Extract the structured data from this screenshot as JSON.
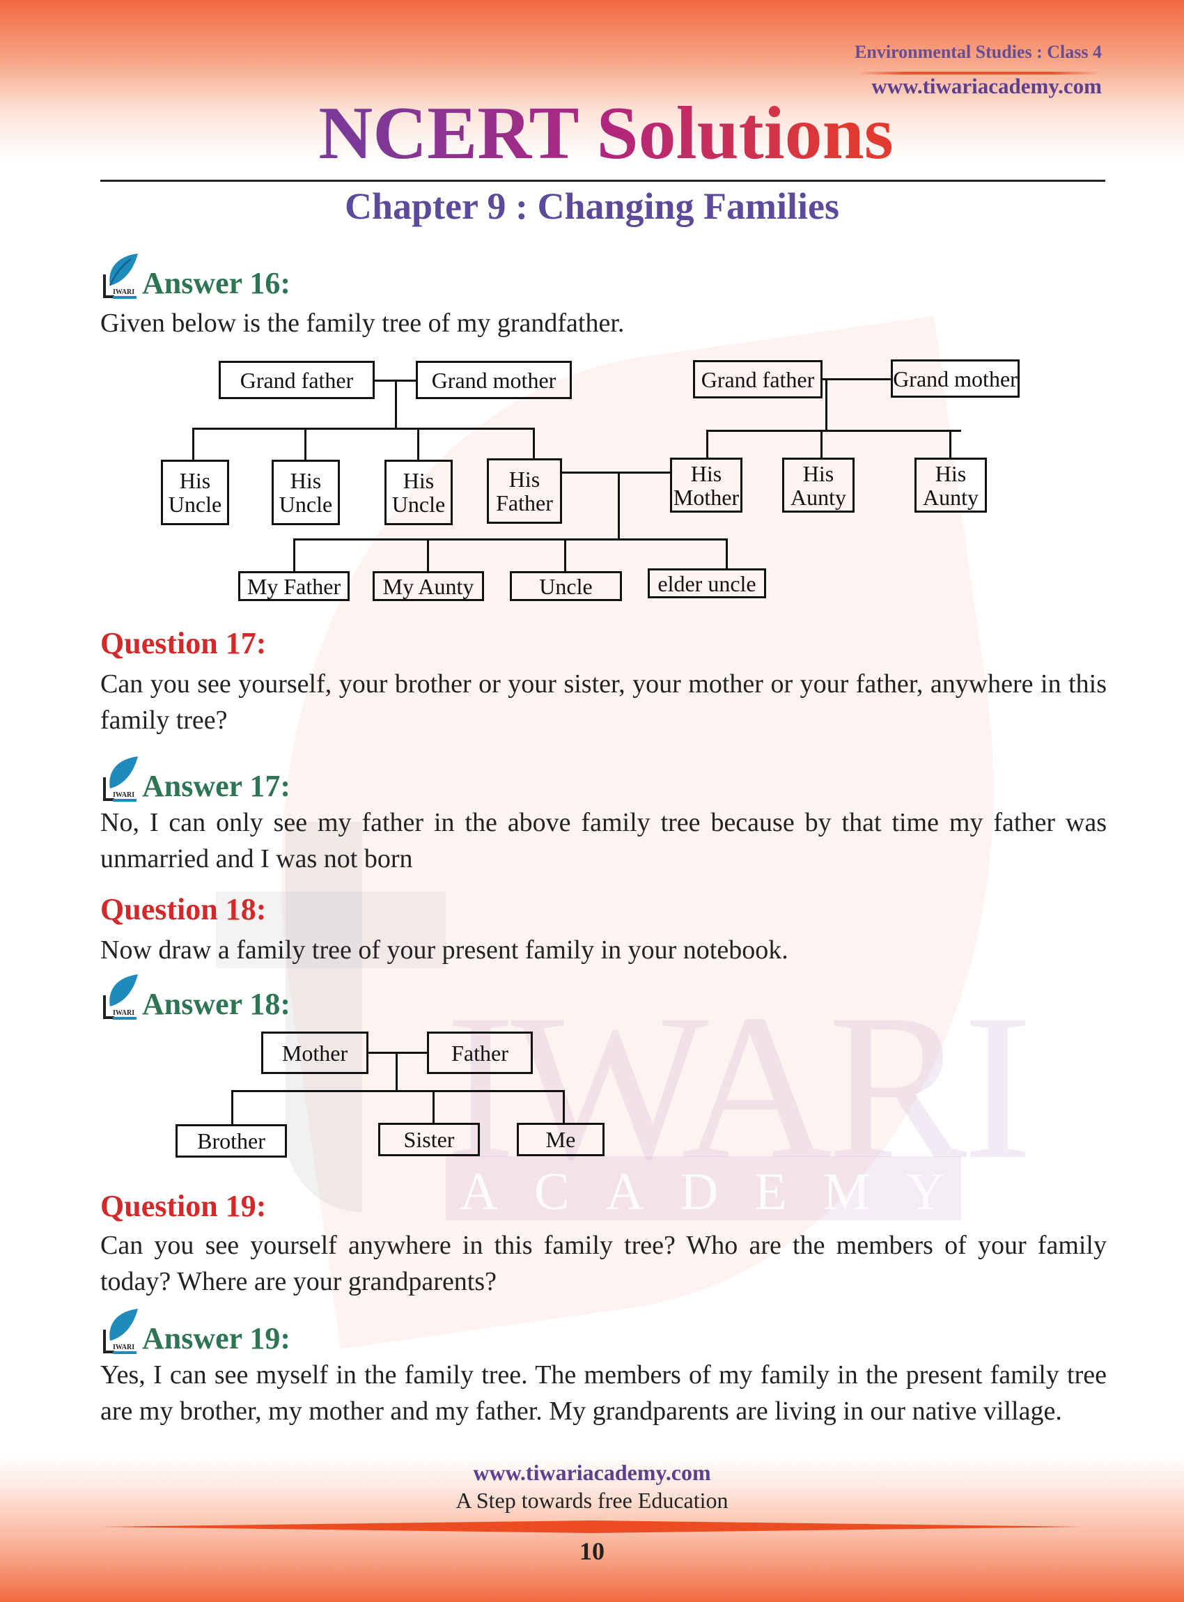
{
  "header": {
    "subject": "Environmental Studies : Class 4",
    "website": "www.tiwariacademy.com",
    "title": "NCERT Solutions",
    "chapter": "Chapter 9 : Changing Families"
  },
  "watermark": {
    "brand": "IWARI",
    "sub": "ACADEMY"
  },
  "logo": {
    "text": "IWARI"
  },
  "sections": [
    {
      "type": "answer",
      "heading": "Answer 16:",
      "text": "Given below is the family tree of my grandfather."
    },
    {
      "type": "question",
      "heading": "Question 17:",
      "text": "Can you see yourself, your brother or your sister, your mother or your father, anywhere in this family tree?"
    },
    {
      "type": "answer",
      "heading": "Answer 17:",
      "text": "No, I can only see my father in the above family tree because by that time my father was unmarried and I was not born"
    },
    {
      "type": "question",
      "heading": "Question 18:",
      "text": "Now draw a family tree of your present family in your notebook."
    },
    {
      "type": "answer",
      "heading": "Answer 18:",
      "text": ""
    },
    {
      "type": "question",
      "heading": "Question 19:",
      "text": "Can you see yourself anywhere in this family tree? Who are the members of your family today? Where are your grandparents?"
    },
    {
      "type": "answer",
      "heading": "Answer 19:",
      "text": "Yes, I can see myself in the family tree. The members of my family in the present family tree  are my brother, my mother and my father. My grandparents are living in our native village."
    }
  ],
  "tree1": {
    "paternal_grandparents": [
      "Grand father",
      "Grand mother"
    ],
    "maternal_grandparents": [
      "Grand father",
      "Grand mother"
    ],
    "paternal_children": [
      "His Uncle",
      "His Uncle",
      "His Uncle",
      "His Father"
    ],
    "maternal_children": [
      "His Mother",
      "His Aunty",
      "His Aunty"
    ],
    "grandchildren": [
      "My Father",
      "My Aunty",
      "Uncle",
      "elder uncle"
    ],
    "two_line_labels": [
      [
        "His",
        "Uncle"
      ],
      [
        "His",
        "Uncle"
      ],
      [
        "His",
        "Uncle"
      ],
      [
        "His",
        "Father"
      ],
      [
        "His",
        "Mother"
      ],
      [
        "His",
        "Aunty"
      ],
      [
        "His",
        "Aunty"
      ]
    ]
  },
  "tree2": {
    "parents": [
      "Mother",
      "Father"
    ],
    "children": [
      "Brother",
      "Sister",
      "Me"
    ]
  },
  "footer": {
    "website": "www.tiwariacademy.com",
    "tagline": "A Step towards free Education",
    "page_number": "10"
  }
}
